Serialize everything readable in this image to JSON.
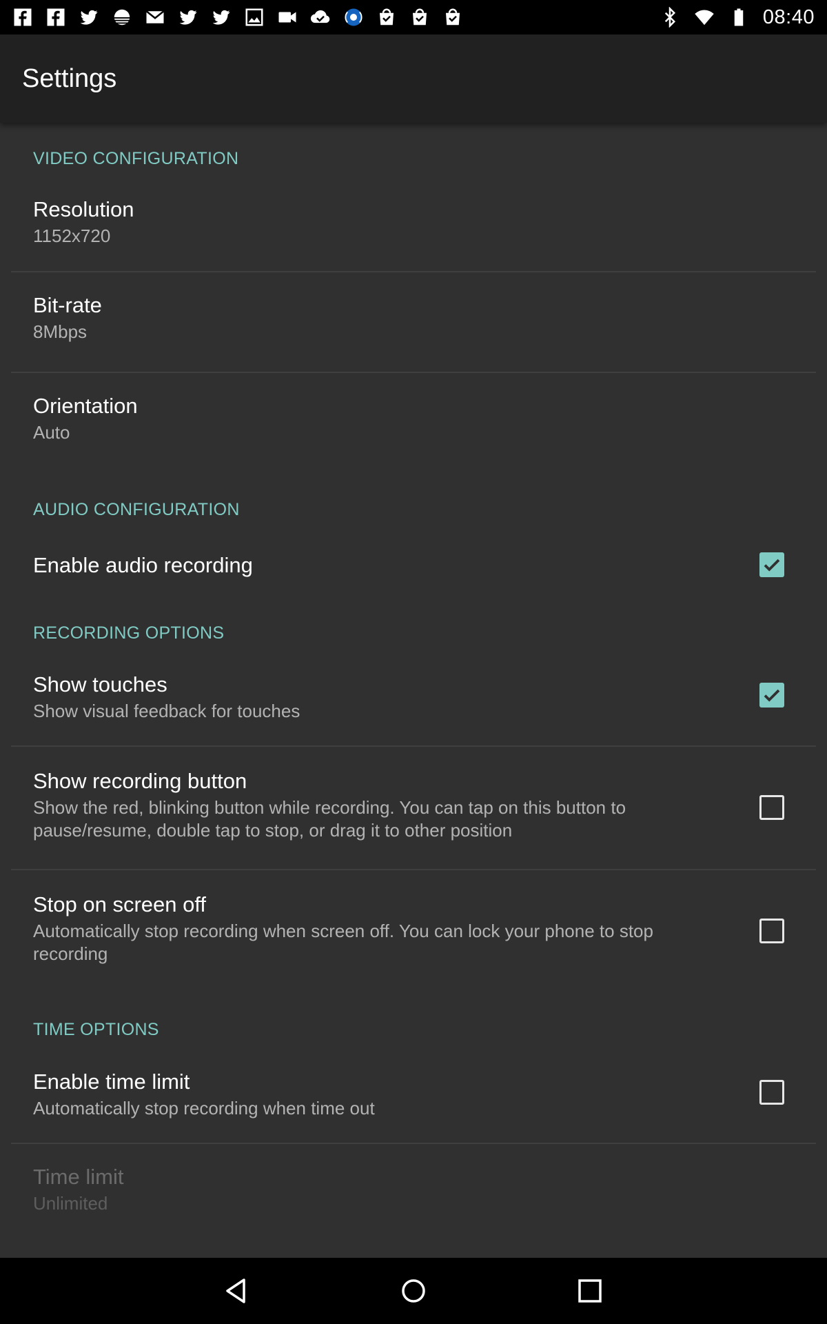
{
  "status_bar": {
    "notification_icons": [
      "facebook-icon",
      "facebook-icon",
      "twitter-icon",
      "sunset-icon",
      "mail-icon",
      "twitter-icon",
      "twitter-icon",
      "image-icon",
      "video-camera-icon",
      "cloud-check-icon",
      "recorder-icon",
      "shopping-bag-check-icon",
      "shopping-bag-check-icon",
      "shopping-bag-check-icon"
    ],
    "time": "08:40"
  },
  "app_bar": {
    "title": "Settings"
  },
  "sections": {
    "video": {
      "header": "VIDEO CONFIGURATION",
      "resolution": {
        "title": "Resolution",
        "summary": "1152x720"
      },
      "bitrate": {
        "title": "Bit-rate",
        "summary": "8Mbps"
      },
      "orientation": {
        "title": "Orientation",
        "summary": "Auto"
      }
    },
    "audio": {
      "header": "AUDIO CONFIGURATION",
      "enable_audio": {
        "title": "Enable audio recording",
        "checked": true
      }
    },
    "recording": {
      "header": "RECORDING OPTIONS",
      "show_touches": {
        "title": "Show touches",
        "summary": "Show visual feedback for touches",
        "checked": true
      },
      "show_button": {
        "title": "Show recording button",
        "summary": "Show the red, blinking button while recording. You can tap on this button to pause/resume, double tap to stop, or drag it to other position",
        "checked": false
      },
      "stop_screen_off": {
        "title": "Stop on screen off",
        "summary": "Automatically stop recording when screen off. You can lock your phone to stop recording",
        "checked": false
      }
    },
    "time": {
      "header": "TIME OPTIONS",
      "enable_limit": {
        "title": "Enable time limit",
        "summary": "Automatically stop recording when time out",
        "checked": false
      },
      "time_limit": {
        "title": "Time limit",
        "summary": "Unlimited",
        "enabled": false
      }
    }
  },
  "colors": {
    "accent": "#80cbc4",
    "background": "#303030",
    "app_bar": "#212121"
  }
}
